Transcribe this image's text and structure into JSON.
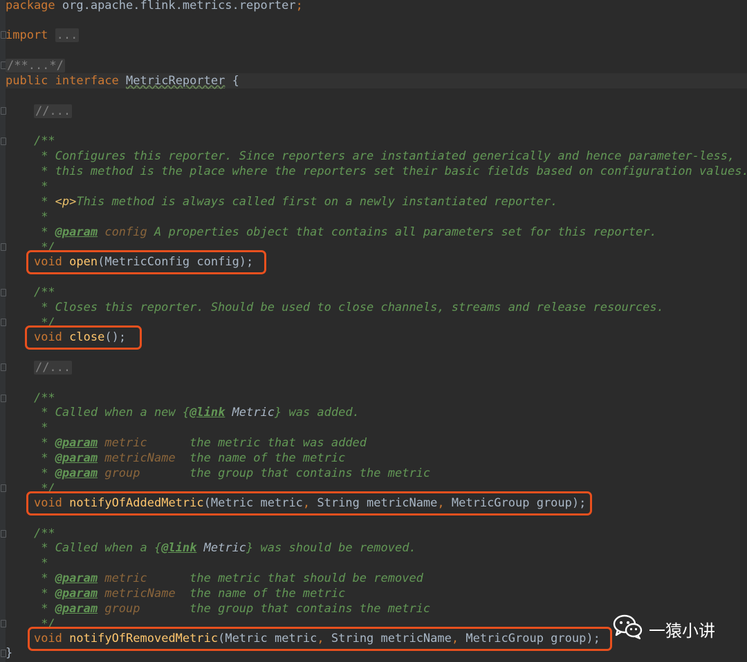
{
  "editor": {
    "package_kw": "package",
    "package_name": " org.apache.flink.metrics.reporter",
    "package_semi": ";",
    "import_kw": "import",
    "import_fold": "...",
    "header_comment": "/**...*/",
    "iface_public": "public",
    "iface_interface": "interface",
    "iface_name": "MetricReporter",
    "iface_brace": " {",
    "fold1": "//...",
    "fold2": "//...",
    "closing_brace": "}",
    "open_doc": {
      "start": "/**",
      "l1": " * Configures this reporter. Since reporters are instantiated generically and hence parameter-less,",
      "l2": " * this method is the place where the reporters set their basic fields based on configuration values.",
      "l3": " *",
      "l4_pre": " * ",
      "l4_tag": "<p>",
      "l4_post": "This method is always called first on a newly instantiated reporter.",
      "l5": " *",
      "l6_pre": " * ",
      "l6_tag": "@param",
      "l6_name": " config",
      "l6_post": " A properties object that contains all parameters set for this reporter.",
      "end": " */"
    },
    "open_sig": {
      "void": "void",
      "name": "open",
      "rest": "(MetricConfig config);"
    },
    "close_doc": {
      "start": "/**",
      "l1": " * Closes this reporter. Should be used to close channels, streams and release resources.",
      "end": " */"
    },
    "close_sig": {
      "void": "void",
      "name": "close",
      "rest": "();"
    },
    "added_doc": {
      "start": "/**",
      "l1_pre": " * Called when a new ",
      "l1_brace_open": "{",
      "l1_tag": "@link",
      "l1_ref": " Metric",
      "l1_brace_close": "}",
      "l1_post": " was added.",
      "l2": " *",
      "p1_pre": " * ",
      "p1_tag": "@param",
      "p1_name": " metric     ",
      "p1_desc": " the metric that was added",
      "p2_pre": " * ",
      "p2_tag": "@param",
      "p2_name": " metricName ",
      "p2_desc": " the name of the metric",
      "p3_pre": " * ",
      "p3_tag": "@param",
      "p3_name": " group      ",
      "p3_desc": " the group that contains the metric",
      "end": " */"
    },
    "added_sig": {
      "void": "void",
      "name": "notifyOfAddedMetric",
      "a1": "(Metric metric",
      "c1": ",",
      "a2": " String metricName",
      "c2": ",",
      "a3": " MetricGroup group);"
    },
    "removed_doc": {
      "start": "/**",
      "l1_pre": " * Called when a ",
      "l1_brace_open": "{",
      "l1_tag": "@link",
      "l1_ref": " Metric",
      "l1_brace_close": "}",
      "l1_post": " was should be removed.",
      "l2": " *",
      "p1_pre": " * ",
      "p1_tag": "@param",
      "p1_name": " metric     ",
      "p1_desc": " the metric that should be removed",
      "p2_pre": " * ",
      "p2_tag": "@param",
      "p2_name": " metricName ",
      "p2_desc": " the name of the metric",
      "p3_pre": " * ",
      "p3_tag": "@param",
      "p3_name": " group      ",
      "p3_desc": " the group that contains the metric",
      "end": " */"
    },
    "removed_sig": {
      "void": "void",
      "name": "notifyOfRemovedMetric",
      "a1": "(Metric metric",
      "c1": ",",
      "a2": " String metricName",
      "c2": ",",
      "a3": " MetricGroup group);"
    }
  },
  "watermark": {
    "icon": "wechat-icon",
    "text": "一猿小讲"
  },
  "colors": {
    "highlight": "#e8501e",
    "background": "#2b2b2b",
    "keyword": "#cc7832",
    "doc": "#629755"
  }
}
